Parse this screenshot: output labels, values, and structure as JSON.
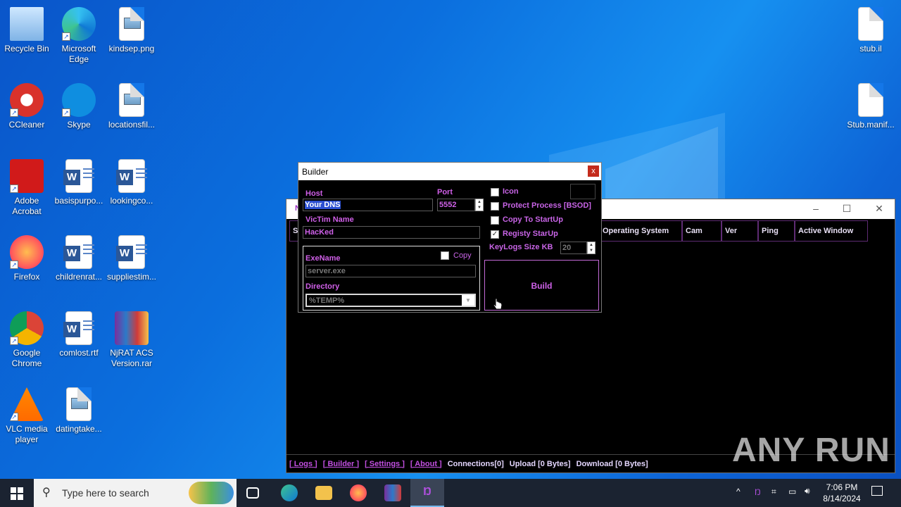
{
  "desktop_icons": [
    {
      "label": "Recycle Bin",
      "icon": "recycle-bin-icon"
    },
    {
      "label": "Microsoft Edge",
      "icon": "edge-icon"
    },
    {
      "label": "kindsep.png",
      "icon": "image-file-icon"
    },
    {
      "label": "stub.il",
      "icon": "file-icon"
    },
    {
      "label": "CCleaner",
      "icon": "ccleaner-icon"
    },
    {
      "label": "Skype",
      "icon": "skype-icon"
    },
    {
      "label": "locationsfil...",
      "icon": "image-file-icon"
    },
    {
      "label": "Stub.manif...",
      "icon": "file-icon"
    },
    {
      "label": "Adobe Acrobat",
      "icon": "acrobat-icon"
    },
    {
      "label": "basispurpo...",
      "icon": "word-doc-icon"
    },
    {
      "label": "lookingco...",
      "icon": "word-doc-icon"
    },
    {
      "label": "Firefox",
      "icon": "firefox-icon"
    },
    {
      "label": "childrenrat...",
      "icon": "word-doc-icon"
    },
    {
      "label": "suppliestim...",
      "icon": "word-doc-icon"
    },
    {
      "label": "Google Chrome",
      "icon": "chrome-icon"
    },
    {
      "label": "comlost.rtf",
      "icon": "word-doc-icon"
    },
    {
      "label": "NjRAT ACS Version.rar",
      "icon": "winrar-icon"
    },
    {
      "label": "VLC media player",
      "icon": "vlc-icon"
    },
    {
      "label": "datingtake...",
      "icon": "image-file-icon"
    }
  ],
  "main_window": {
    "title_prefix": "N",
    "left_tab": "Sc",
    "columns": [
      "Operating System",
      "Cam",
      "Ver",
      "Ping",
      "Active Window"
    ],
    "status": {
      "logs": "[ Logs ]",
      "builder": "[ Builder ]",
      "settings": "[ Settings ]",
      "about": "[ About ]",
      "connections": "Connections[0]",
      "upload": "Upload [0 Bytes]",
      "download": "Download [0 Bytes]"
    }
  },
  "builder": {
    "title": "Builder",
    "close": "x",
    "host_label": "Host",
    "host_value": "Your DNS",
    "port_label": "Port",
    "port_value": "5552",
    "victim_label": "VicTim Name",
    "victim_value": "HacKed",
    "exename_label": "ExeName",
    "copy_label": "Copy",
    "exename_value": "server.exe",
    "directory_label": "Directory",
    "directory_value": "%TEMP%",
    "options": [
      {
        "label": "Icon",
        "checked": false
      },
      {
        "label": "Protect Process [BSOD]",
        "checked": false
      },
      {
        "label": "Copy To StartUp",
        "checked": false
      },
      {
        "label": "Registy StarUp",
        "checked": true
      }
    ],
    "keylogs_label": "KeyLogs Size KB",
    "keylogs_value": "20",
    "build_label": "Build"
  },
  "taskbar": {
    "search_placeholder": "Type here to search",
    "time": "7:06 PM",
    "date": "8/14/2024"
  },
  "watermark": "ANY RUN"
}
